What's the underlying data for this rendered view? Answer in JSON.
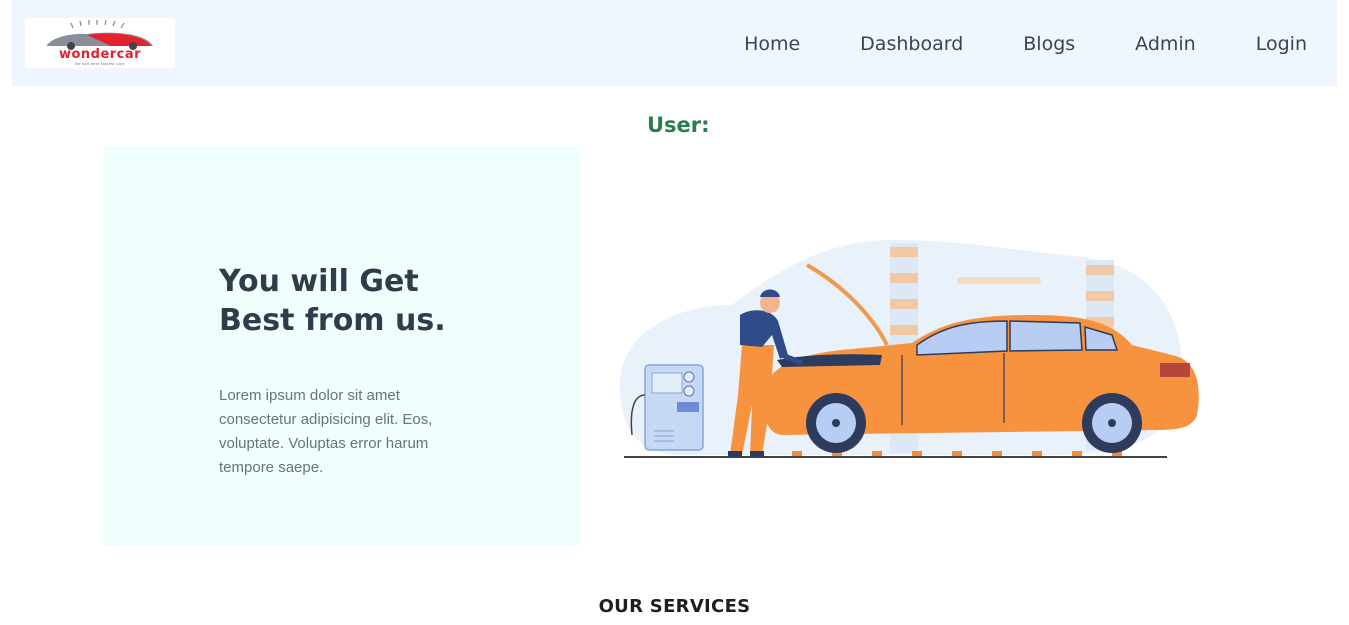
{
  "brand": {
    "name": "wondercar",
    "tagline": "we sell best fastest cars",
    "colors": {
      "primary": "#e5212d",
      "nav_bg": "#eff6fd"
    }
  },
  "nav": {
    "items": [
      {
        "label": "Home"
      },
      {
        "label": "Dashboard"
      },
      {
        "label": "Blogs"
      },
      {
        "label": "Admin"
      },
      {
        "label": "Login"
      }
    ]
  },
  "user": {
    "label": "User:"
  },
  "hero": {
    "title": "You will Get Best from us.",
    "text": "Lorem ipsum dolor sit amet consectetur adipisicing elit. Eos, voluptate. Voluptas error harum tempore saepe.",
    "illustration": "mechanic-repairing-car-illustration"
  },
  "services": {
    "title": "OUR SERVICES"
  }
}
